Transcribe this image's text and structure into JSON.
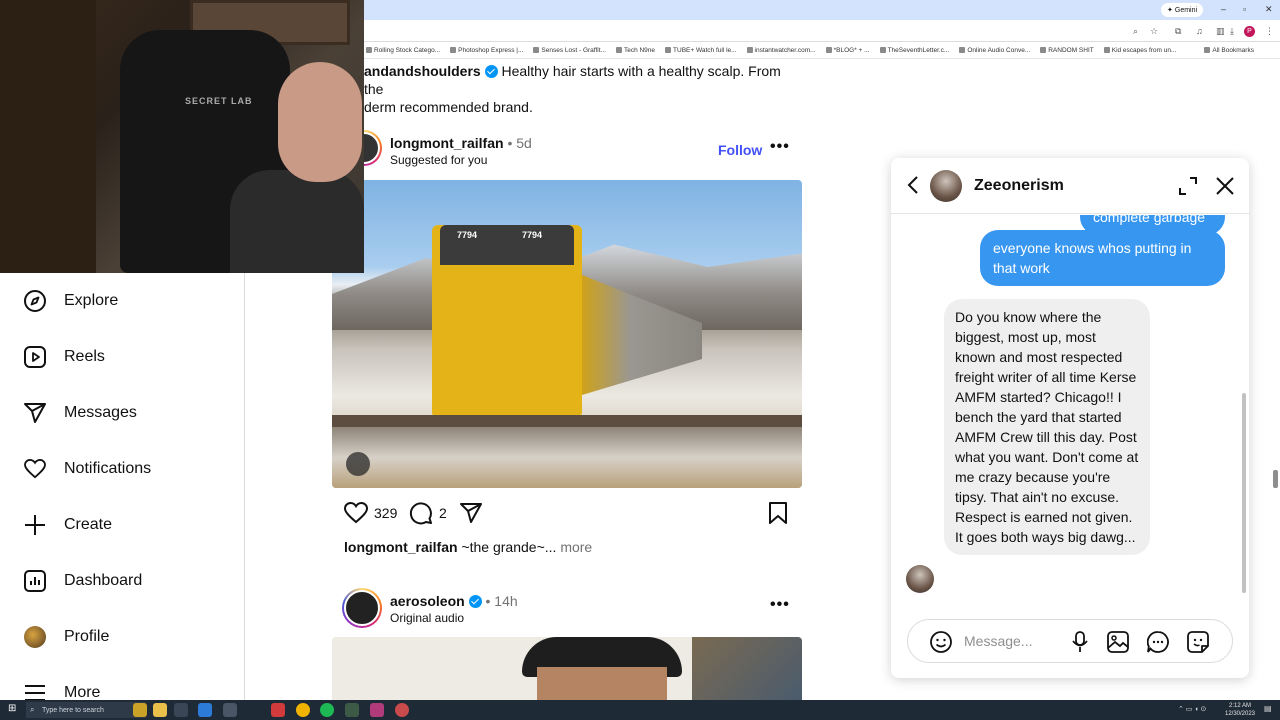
{
  "browser": {
    "gemini_label": "Gemini",
    "bookmarks": [
      "Rolling Stock Catego...",
      "Photoshop Express |...",
      "Senses Lost - Graffit...",
      "Tech N9ne",
      "TUBE+ Watch full le...",
      "instantwatcher.com...",
      "*BLOG* + ...",
      "TheSeventhLetter.c...",
      "Online Audio Conve...",
      "RANDOM SHIT",
      "Kid escapes from un..."
    ],
    "all_bookmarks": "All Bookmarks",
    "profile_initial": "P"
  },
  "webcam": {
    "chair_brand": "SECRET LAB"
  },
  "nav": {
    "items": [
      {
        "label": "Explore",
        "icon": "compass-icon"
      },
      {
        "label": "Reels",
        "icon": "reels-icon"
      },
      {
        "label": "Messages",
        "icon": "messages-icon"
      },
      {
        "label": "Notifications",
        "icon": "heart-icon"
      },
      {
        "label": "Create",
        "icon": "plus-icon"
      },
      {
        "label": "Dashboard",
        "icon": "dashboard-icon"
      },
      {
        "label": "Profile",
        "icon": "profile-avatar"
      },
      {
        "label": "More",
        "icon": "menu-icon"
      }
    ]
  },
  "feed": {
    "ad_post": {
      "username": "andandshoulders",
      "caption_line1": "Healthy hair starts with a healthy scalp. From the",
      "caption_line2": "derm recommended brand."
    },
    "post1": {
      "username": "longmont_railfan",
      "age": "5d",
      "subtitle": "Suggested for you",
      "follow_label": "Follow",
      "likes": "329",
      "comments": "2",
      "caption_user": "longmont_railfan",
      "caption_text": "~the grande~...",
      "more_label": "more",
      "locomotive_number": "7794"
    },
    "post2": {
      "username": "aerosoleon",
      "age": "14h",
      "subtitle": "Original audio"
    }
  },
  "chat": {
    "contact_name": "Zeeonerism",
    "partial_message": "complete garbage",
    "sent_message": "everyone knows whos putting in that work",
    "received_message": "Do you know where the biggest, most up, most known and most respected freight writer of all time Kerse AMFM started? Chicago!! I bench the yard that started AMFM Crew till this day. Post what you want. Don't come at me crazy because you're tipsy. That ain't no excuse. Respect is earned not given. It goes both ways big dawg...",
    "composer_placeholder": "Message..."
  },
  "taskbar": {
    "search_placeholder": "Type here to search",
    "time": "2:12 AM",
    "date": "12/30/2023"
  },
  "colors": {
    "accent": "#0095f6",
    "follow_text": "#4150f7",
    "bubble_outgoing": "#3797f0",
    "bubble_incoming": "#efefef"
  }
}
